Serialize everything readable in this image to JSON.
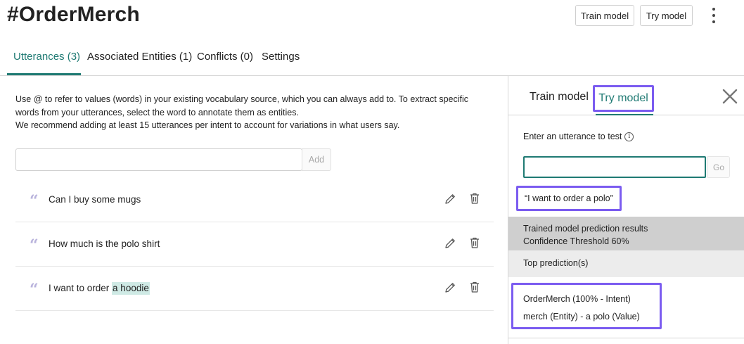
{
  "header": {
    "title": "#OrderMerch",
    "train_button": "Train model",
    "try_button": "Try model",
    "more_icon": "kebab-vertical-icon"
  },
  "tabs": [
    {
      "label": "Utterances (3)",
      "active": true
    },
    {
      "label": "Associated Entities (1)",
      "active": false
    },
    {
      "label": "Conflicts (0)",
      "active": false
    },
    {
      "label": "Settings",
      "active": false
    }
  ],
  "main": {
    "description_line1": "Use @ to refer to values (words) in your existing vocabulary source, which you can always add to. To extract specific words from your utterances, select the word to annotate them as entities.",
    "description_line2": "We recommend adding at least 15 utterances per intent to account for variations in what users say.",
    "input_value": "",
    "add_label": "Add",
    "utterances": [
      {
        "prefix": "Can I buy some mugs",
        "entity": ""
      },
      {
        "prefix": "How much is the polo shirt",
        "entity": ""
      },
      {
        "prefix": "I want to order ",
        "entity": "a hoodie"
      }
    ]
  },
  "panel": {
    "tab_train": "Train model",
    "tab_try": "Try model",
    "active_tab": "Try model",
    "enter_label": "Enter an utterance to test",
    "input_value": "",
    "go_label": "Go",
    "echo": "“I want to order a polo”",
    "results_line1": "Trained model prediction results",
    "results_line2": "Confidence Threshold 60%",
    "top_predictions_label": "Top prediction(s)",
    "prediction_intent": "OrderMerch (100% - Intent)",
    "prediction_entity": "merch (Entity) - a polo (Value)"
  },
  "colors": {
    "accent": "#1f7a73",
    "highlight_border": "#7b5cf0",
    "entity_highlight": "#cfeae5",
    "results_bg": "#cfcfcf",
    "top_pred_bg": "#ececec"
  }
}
